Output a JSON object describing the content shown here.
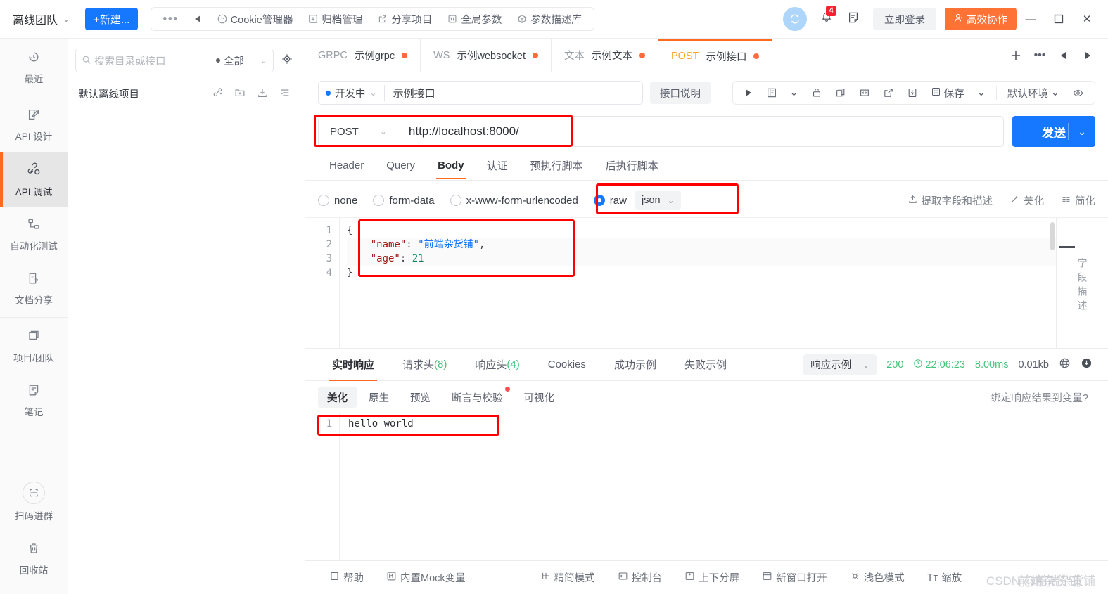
{
  "topbar": {
    "team_name": "离线团队",
    "new_button": "+新建...",
    "menu_items": [
      {
        "label": "Cookie管理器",
        "icon": "cookie-icon"
      },
      {
        "label": "归档管理",
        "icon": "archive-icon"
      },
      {
        "label": "分享项目",
        "icon": "share-icon"
      },
      {
        "label": "全局参数",
        "icon": "params-icon"
      },
      {
        "label": "参数描述库",
        "icon": "param-library-icon"
      }
    ],
    "notification_count": "4",
    "login_label": "立即登录",
    "collab_label": "高效协作",
    "window_minimize": "—",
    "window_maximize": "▢",
    "window_close": "✕"
  },
  "leftnav": {
    "items": [
      {
        "label": "最近",
        "icon": "history-icon",
        "active": false
      },
      {
        "label": "API 设计",
        "icon": "design-icon",
        "active": false
      },
      {
        "label": "API 调试",
        "icon": "debug-icon",
        "active": true
      },
      {
        "label": "自动化测试",
        "icon": "automation-icon",
        "active": false
      },
      {
        "label": "文档分享",
        "icon": "doc-share-icon",
        "active": false
      },
      {
        "label": "项目/团队",
        "icon": "project-team-icon",
        "active": false
      },
      {
        "label": "笔记",
        "icon": "notes-icon",
        "active": false
      }
    ],
    "bottom_items": [
      {
        "label": "扫码进群",
        "icon": "qrcode-icon"
      },
      {
        "label": "回收站",
        "icon": "trash-icon"
      }
    ]
  },
  "directory": {
    "search_placeholder": "搜索目录或接口",
    "filter_label": "全部",
    "project_name": "默认离线项目",
    "project_actions": [
      "add-member-icon",
      "new-folder-icon",
      "import-icon",
      "list-options-icon"
    ],
    "locate_icon": "locate-icon"
  },
  "tabs": {
    "items": [
      {
        "method": "GRPC",
        "name": "示例grpc",
        "dirty": true,
        "active": false
      },
      {
        "method": "WS",
        "name": "示例websocket",
        "dirty": true,
        "active": false
      },
      {
        "method": "文本",
        "name": "示例文本",
        "dirty": true,
        "active": false
      },
      {
        "method": "POST",
        "name": "示例接口",
        "dirty": true,
        "active": true
      }
    ],
    "right_icons": [
      "add-tab-icon",
      "more-tabs-icon",
      "prev-tab-icon",
      "next-tab-icon"
    ]
  },
  "meta": {
    "status_label": "开发中",
    "interface_name": "示例接口",
    "description_button": "接口说明",
    "actions": [
      {
        "label": "",
        "icon": "run-icon"
      },
      {
        "label": "",
        "icon": "doc-icon"
      },
      {
        "label": "",
        "icon": "chevron-down-icon"
      },
      {
        "label": "",
        "icon": "unlock-icon"
      },
      {
        "label": "",
        "icon": "copy-icon"
      },
      {
        "label": "",
        "icon": "code-icon"
      },
      {
        "label": "",
        "icon": "export-icon"
      },
      {
        "label": "",
        "icon": "mock-icon"
      }
    ],
    "save_label": "保存",
    "env_label": "默认环境",
    "eye_icon": "eye-icon"
  },
  "request": {
    "method": "POST",
    "url": "http://localhost:8000/",
    "send_label": "发送",
    "tabs": [
      {
        "label": "Header",
        "active": false
      },
      {
        "label": "Query",
        "active": false
      },
      {
        "label": "Body",
        "active": true
      },
      {
        "label": "认证",
        "active": false
      },
      {
        "label": "预执行脚本",
        "active": false
      },
      {
        "label": "后执行脚本",
        "active": false
      }
    ],
    "body_types": [
      {
        "label": "none",
        "selected": false
      },
      {
        "label": "form-data",
        "selected": false
      },
      {
        "label": "x-www-form-urlencoded",
        "selected": false
      },
      {
        "label": "raw",
        "selected": true
      }
    ],
    "raw_format": "json",
    "tools": [
      {
        "label": "提取字段和描述",
        "icon": "extract-icon"
      },
      {
        "label": "美化",
        "icon": "beautify-icon"
      },
      {
        "label": "简化",
        "icon": "simplify-icon"
      }
    ],
    "body_lines": [
      {
        "no": "1",
        "text": "{"
      },
      {
        "no": "2",
        "text": "    \"name\": \"前端杂货铺\","
      },
      {
        "no": "3",
        "text": "    \"age\": 21"
      },
      {
        "no": "4",
        "text": "}"
      }
    ],
    "body_json": {
      "name": "前端杂货铺",
      "age": "21"
    },
    "side_rail_label": "字段描述"
  },
  "response": {
    "tabs": [
      {
        "label": "实时响应",
        "count": "",
        "active": true
      },
      {
        "label": "请求头",
        "count": "(8)",
        "active": false
      },
      {
        "label": "响应头",
        "count": "(4)",
        "active": false
      },
      {
        "label": "Cookies",
        "count": "",
        "active": false
      },
      {
        "label": "成功示例",
        "count": "",
        "active": false
      },
      {
        "label": "失败示例",
        "count": "",
        "active": false
      }
    ],
    "example_select": "响应示例",
    "status_code": "200",
    "time": "22:06:23",
    "duration": "8.00ms",
    "size": "0.01kb",
    "globe_icon": "globe-icon",
    "download_icon": "download-icon",
    "view_tabs": [
      {
        "label": "美化",
        "active": true,
        "dot": false
      },
      {
        "label": "原生",
        "active": false,
        "dot": false
      },
      {
        "label": "预览",
        "active": false,
        "dot": false
      },
      {
        "label": "断言与校验",
        "active": false,
        "dot": true
      },
      {
        "label": "可视化",
        "active": false,
        "dot": false
      }
    ],
    "bind_label": "绑定响应结果到变量?",
    "body_lines": [
      {
        "no": "1",
        "text": "hello world"
      }
    ]
  },
  "statusbar": {
    "items": [
      {
        "label": "帮助",
        "icon": "help-icon"
      },
      {
        "label": "内置Mock变量",
        "icon": "mock-var-icon"
      },
      {
        "label": "精简模式",
        "icon": "compact-icon"
      },
      {
        "label": "控制台",
        "icon": "console-icon"
      },
      {
        "label": "上下分屏",
        "icon": "split-icon"
      },
      {
        "label": "新窗口打开",
        "icon": "new-window-icon"
      },
      {
        "label": "浅色模式",
        "icon": "light-mode-icon"
      },
      {
        "label": "缩放",
        "icon": "zoom-icon"
      }
    ],
    "watermark": "CSDN @前端杂货铺",
    "watermark_overlay": "前端杂货铺"
  },
  "colors": {
    "primary": "#1677ff",
    "accent": "#ff6a1f",
    "success": "#46c37b",
    "danger": "#ff0000"
  }
}
